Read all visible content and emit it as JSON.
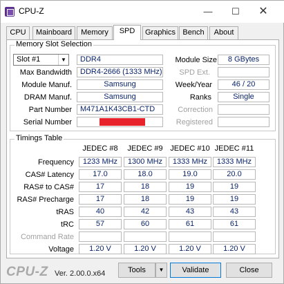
{
  "window": {
    "title": "CPU-Z"
  },
  "titlebar": {
    "minimize": "—",
    "maximize": "☐",
    "close": "✕"
  },
  "tabs": [
    "CPU",
    "Mainboard",
    "Memory",
    "SPD",
    "Graphics",
    "Bench",
    "About"
  ],
  "active_tab": "SPD",
  "memory_slot": {
    "group_label": "Memory Slot Selection",
    "slot_select": "Slot #1",
    "type": "DDR4",
    "module_size_label": "Module Size",
    "module_size": "8 GBytes",
    "max_bandwidth_label": "Max Bandwidth",
    "max_bandwidth": "DDR4-2666 (1333 MHz)",
    "spd_ext_label": "SPD Ext.",
    "spd_ext": "",
    "module_manuf_label": "Module Manuf.",
    "module_manuf": "Samsung",
    "week_year_label": "Week/Year",
    "week_year": "46 / 20",
    "dram_manuf_label": "DRAM Manuf.",
    "dram_manuf": "Samsung",
    "ranks_label": "Ranks",
    "ranks": "Single",
    "part_number_label": "Part Number",
    "part_number": "M471A1K43CB1-CTD",
    "correction_label": "Correction",
    "correction": "",
    "serial_number_label": "Serial Number",
    "registered_label": "Registered",
    "registered": ""
  },
  "timings": {
    "group_label": "Timings Table",
    "columns": [
      "JEDEC #8",
      "JEDEC #9",
      "JEDEC #10",
      "JEDEC #11"
    ],
    "rows": [
      {
        "label": "Frequency",
        "values": [
          "1233 MHz",
          "1300 MHz",
          "1333 MHz",
          "1333 MHz"
        ],
        "dim": false
      },
      {
        "label": "CAS# Latency",
        "values": [
          "17.0",
          "18.0",
          "19.0",
          "20.0"
        ],
        "dim": false
      },
      {
        "label": "RAS# to CAS#",
        "values": [
          "17",
          "18",
          "19",
          "19"
        ],
        "dim": false
      },
      {
        "label": "RAS# Precharge",
        "values": [
          "17",
          "18",
          "19",
          "19"
        ],
        "dim": false
      },
      {
        "label": "tRAS",
        "values": [
          "40",
          "42",
          "43",
          "43"
        ],
        "dim": false
      },
      {
        "label": "tRC",
        "values": [
          "57",
          "60",
          "61",
          "61"
        ],
        "dim": false
      },
      {
        "label": "Command Rate",
        "values": [
          "",
          "",
          "",
          ""
        ],
        "dim": true
      },
      {
        "label": "Voltage",
        "values": [
          "1.20 V",
          "1.20 V",
          "1.20 V",
          "1.20 V"
        ],
        "dim": false
      }
    ]
  },
  "footer": {
    "logo": "CPU-Z",
    "version": "Ver. 2.00.0.x64",
    "tools_label": "Tools",
    "validate_label": "Validate",
    "close_label": "Close"
  },
  "colors": {
    "value_text": "#0a246a",
    "redaction": "#e8222a",
    "tab_border": "#adadad"
  }
}
